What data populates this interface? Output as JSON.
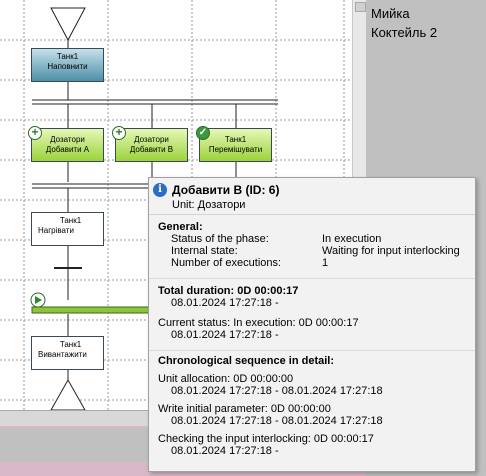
{
  "steps": [
    {
      "unit": "Танк1",
      "phase": "Наповнити"
    },
    {
      "unit": "Дозатори",
      "phase": "Добавити А"
    },
    {
      "unit": "Дозатори",
      "phase": "Добавити В"
    },
    {
      "unit": "Танк1",
      "phase": "Перемішувати"
    },
    {
      "unit": "Танк1",
      "phase": "Нагрівати"
    },
    {
      "unit": "Танк1",
      "phase": "Вивантажити"
    }
  ],
  "right_panel": {
    "items": [
      "Мийка",
      "Коктейль 2"
    ]
  },
  "tooltip": {
    "title": "Добавити В (ID: 6)",
    "subtitle": "Unit: Дозатори",
    "general": {
      "heading": "General:",
      "rows": [
        {
          "key": "Status of the phase:",
          "value": "In execution"
        },
        {
          "key": "Internal state:",
          "value": "Waiting for input interlocking"
        },
        {
          "key": "Number of executions:",
          "value": "1"
        }
      ]
    },
    "total": {
      "heading": "Total  duration: 0D 00:00:17",
      "range": "08.01.2024 17:27:18  -"
    },
    "current": {
      "line": "Current status: In execution: 0D 00:00:17",
      "range": "08.01.2024 17:27:18  -"
    },
    "chrono": {
      "heading": "Chronological sequence in detail:",
      "entries": [
        {
          "line": "Unit allocation: 0D 00:00:00",
          "range": "08.01.2024 17:27:18   - 08.01.2024 17:27:18"
        },
        {
          "line": "Write initial parameter: 0D 00:00:00",
          "range": "08.01.2024 17:27:18   - 08.01.2024 17:27:18"
        },
        {
          "line": "Checking the input interlocking: 0D 00:00:17",
          "range": "08.01.2024 17:27:18  -"
        }
      ]
    }
  }
}
